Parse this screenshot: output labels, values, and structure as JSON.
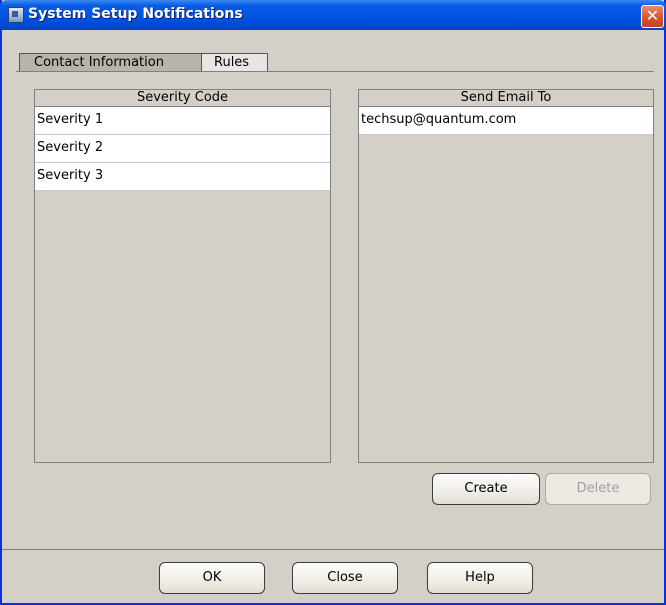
{
  "window": {
    "title": "System Setup Notifications"
  },
  "tabs": [
    {
      "label": "Contact Information",
      "active": true
    },
    {
      "label": "Rules",
      "active": false
    }
  ],
  "severity_table": {
    "header": "Severity Code",
    "rows": [
      "Severity 1",
      "Severity 2",
      "Severity 3"
    ]
  },
  "email_table": {
    "header": "Send Email To",
    "rows": [
      "techsup@quantum.com"
    ]
  },
  "buttons": {
    "create": "Create",
    "delete": "Delete",
    "ok": "OK",
    "close": "Close",
    "help": "Help"
  },
  "icons": {
    "close": "close-icon",
    "app": "app-icon"
  }
}
